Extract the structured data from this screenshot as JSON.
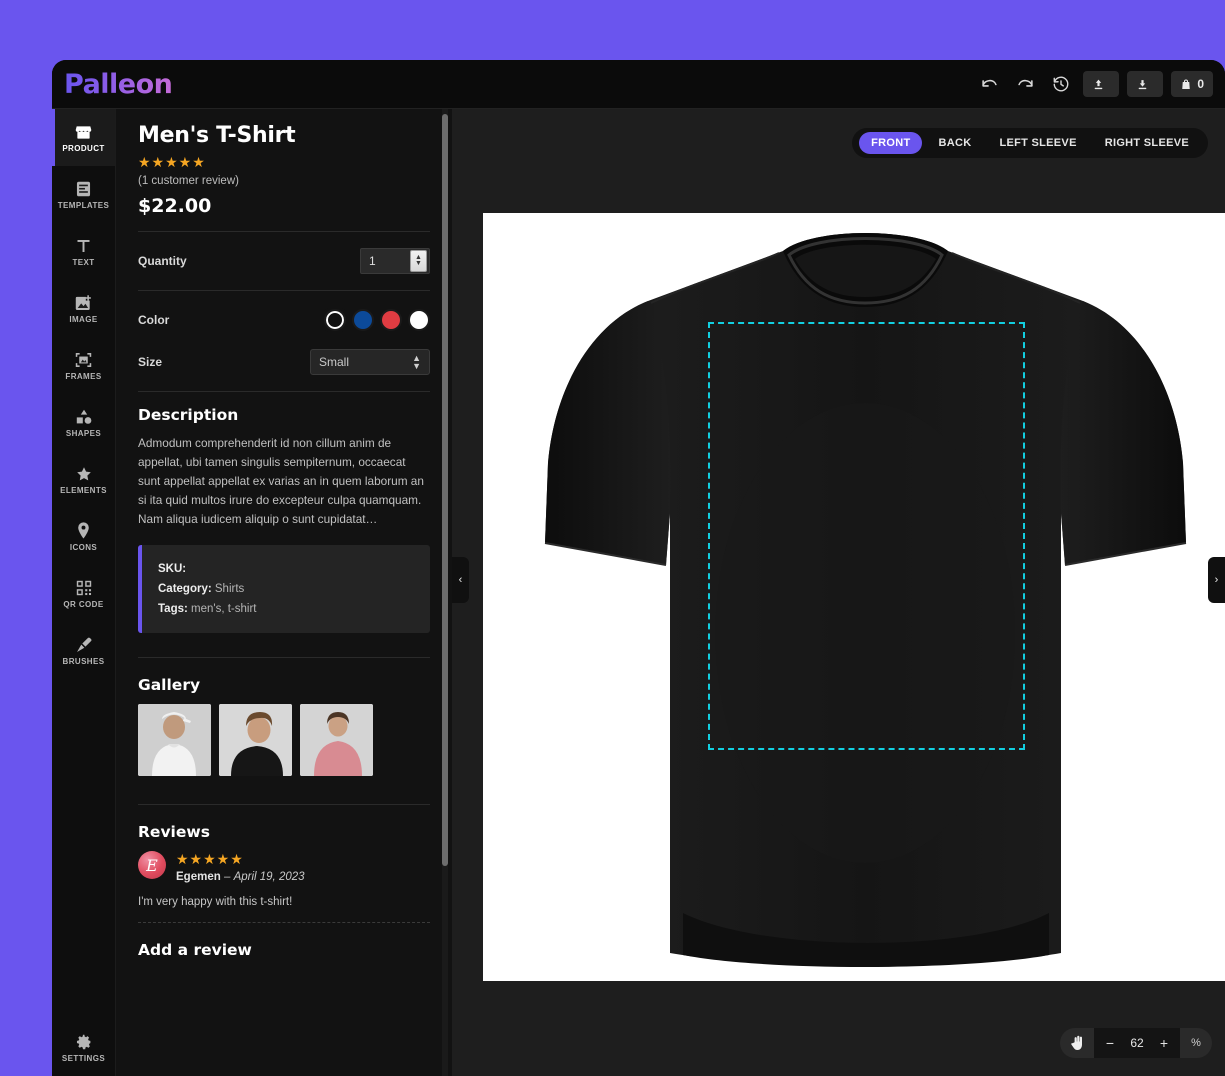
{
  "app": {
    "brand": "Palleon",
    "background_color": "#6a55ee",
    "accent_color": "#6a55ee"
  },
  "toolbar": {
    "undo": "undo-icon",
    "redo": "redo-icon",
    "history": "history-icon",
    "upload_label": "",
    "download_label": "",
    "cart_count": "0"
  },
  "sidebar": {
    "items": [
      {
        "label": "PRODUCT",
        "icon": "store-icon",
        "active": true
      },
      {
        "label": "TEMPLATES",
        "icon": "templates-icon",
        "active": false
      },
      {
        "label": "TEXT",
        "icon": "text-icon",
        "active": false
      },
      {
        "label": "IMAGE",
        "icon": "image-add-icon",
        "active": false
      },
      {
        "label": "FRAMES",
        "icon": "frames-icon",
        "active": false
      },
      {
        "label": "SHAPES",
        "icon": "shapes-icon",
        "active": false
      },
      {
        "label": "ELEMENTS",
        "icon": "star-icon",
        "active": false
      },
      {
        "label": "ICONS",
        "icon": "pin-icon",
        "active": false
      },
      {
        "label": "QR CODE",
        "icon": "qr-code-icon",
        "active": false
      },
      {
        "label": "BRUSHES",
        "icon": "brush-icon",
        "active": false
      }
    ],
    "settings": {
      "label": "SETTINGS",
      "icon": "gear-icon"
    }
  },
  "product": {
    "title": "Men's T-Shirt",
    "stars": "★★★★★",
    "review_count_text": "(1 customer review)",
    "price": "$22.00",
    "quantity": {
      "label": "Quantity",
      "value": "1"
    },
    "color": {
      "label": "Color",
      "options": [
        {
          "name": "black",
          "hex": "#111111",
          "selected": true
        },
        {
          "name": "blue",
          "hex": "#0c4a99",
          "selected": false
        },
        {
          "name": "red",
          "hex": "#e03c42",
          "selected": false
        },
        {
          "name": "white",
          "hex": "#ffffff",
          "selected": false
        }
      ]
    },
    "size": {
      "label": "Size",
      "value": "Small"
    },
    "description": {
      "heading": "Description",
      "text": "Admodum comprehenderit id non cillum anim de appellat, ubi tamen singulis sempiternum, occaecat sunt appellat appellat ex varias an in quem laborum an si ita quid multos irure do excepteur culpa quamquam. Nam aliqua iudicem aliquip o sunt cupidatat…"
    },
    "meta": {
      "sku_label": "SKU:",
      "sku_value": "",
      "category_label": "Category:",
      "category_value": "Shirts",
      "tags_label": "Tags:",
      "tags_value": "men's, t-shirt"
    },
    "gallery": {
      "heading": "Gallery",
      "items": [
        {
          "alt": "model-white-tshirt-cap"
        },
        {
          "alt": "model-black-tshirt"
        },
        {
          "alt": "model-pink-tshirt"
        }
      ]
    },
    "reviews": {
      "heading": "Reviews",
      "items": [
        {
          "avatar_initial": "E",
          "stars": "★★★★★",
          "author": "Egemen",
          "separator": "–",
          "date": "April 19, 2023",
          "body": "I'm very happy with this t-shirt!"
        }
      ],
      "add_review_heading": "Add a review"
    }
  },
  "canvas": {
    "views": [
      {
        "label": "FRONT",
        "active": true
      },
      {
        "label": "BACK",
        "active": false
      },
      {
        "label": "LEFT SLEEVE",
        "active": false
      },
      {
        "label": "RIGHT SLEEVE",
        "active": false
      }
    ],
    "boundary_color": "#12cfe0",
    "product_image_alt": "black-tshirt-front",
    "left_toggle": "‹",
    "right_toggle": "›",
    "zoom": {
      "hand_icon": "pan-hand-icon",
      "minus": "−",
      "value": "62",
      "plus": "+",
      "unit": "%"
    }
  }
}
